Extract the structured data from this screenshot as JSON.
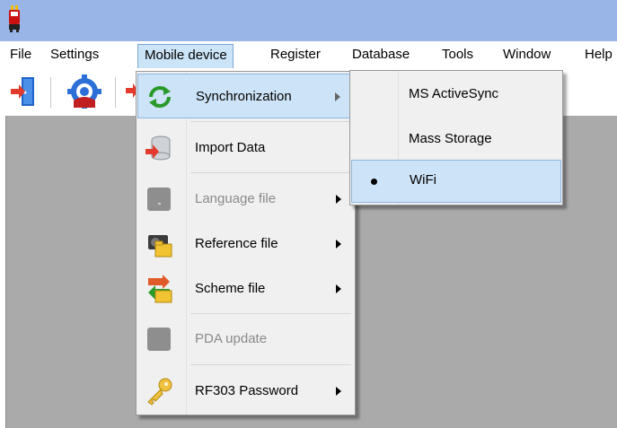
{
  "menubar": {
    "items": [
      {
        "label": "File"
      },
      {
        "label": "Settings"
      },
      {
        "label": "Mobile device"
      },
      {
        "label": "Register"
      },
      {
        "label": "Database"
      },
      {
        "label": "Tools"
      },
      {
        "label": "Window"
      },
      {
        "label": "Help"
      }
    ]
  },
  "mobile_menu": {
    "items": [
      {
        "label": "Synchronization",
        "icon": "sync-icon"
      },
      {
        "label": "Import Data",
        "icon": "import-data-icon"
      },
      {
        "label": "Language file",
        "icon": "language-file-icon"
      },
      {
        "label": "Reference file",
        "icon": "reference-file-icon"
      },
      {
        "label": "Scheme file",
        "icon": "scheme-file-icon"
      },
      {
        "label": "PDA update",
        "icon": "pda-update-icon"
      },
      {
        "label": "RF303 Password",
        "icon": "key-icon"
      }
    ]
  },
  "sync_submenu": {
    "items": [
      {
        "label": "MS ActiveSync"
      },
      {
        "label": "Mass Storage"
      },
      {
        "label": "WiFi"
      }
    ]
  },
  "colors": {
    "titlebar": "#99b4e6",
    "highlight": "#cde3f7",
    "workspace": "#abaaab"
  }
}
